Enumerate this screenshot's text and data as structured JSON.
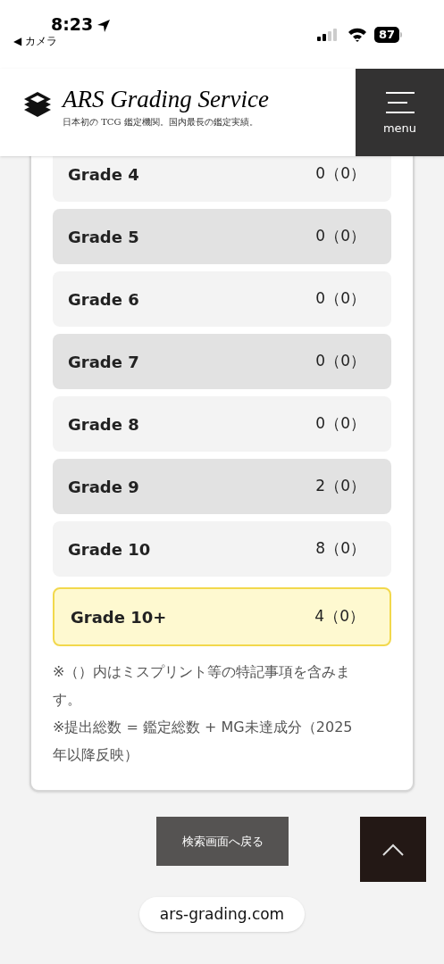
{
  "status_bar": {
    "time": "8:23",
    "back_label": "◀ カメラ",
    "battery": "87"
  },
  "header": {
    "logo_title": "ARS Grading Service",
    "tagline": "日本初の TCG 鑑定機関。国内最長の鑑定実績。",
    "menu_label": "menu"
  },
  "grades": [
    {
      "label": "Grade 4",
      "count": "0（0）",
      "highlighted": false
    },
    {
      "label": "Grade 5",
      "count": "0（0）",
      "highlighted": false
    },
    {
      "label": "Grade 6",
      "count": "0（0）",
      "highlighted": false
    },
    {
      "label": "Grade 7",
      "count": "0（0）",
      "highlighted": false
    },
    {
      "label": "Grade 8",
      "count": "0（0）",
      "highlighted": false
    },
    {
      "label": "Grade 9",
      "count": "2（0）",
      "highlighted": false
    },
    {
      "label": "Grade 10",
      "count": "8（0）",
      "highlighted": false
    },
    {
      "label": "Grade 10+",
      "count": "4（0）",
      "highlighted": true
    }
  ],
  "notes": [
    "※（）内はミスプリント等の特記事項を含みます。",
    "※提出総数 = 鑑定総数 + MG未達成分（2025年以降反映）"
  ],
  "back_button": "検索画面へ戻る",
  "url": "ars-grading.com"
}
